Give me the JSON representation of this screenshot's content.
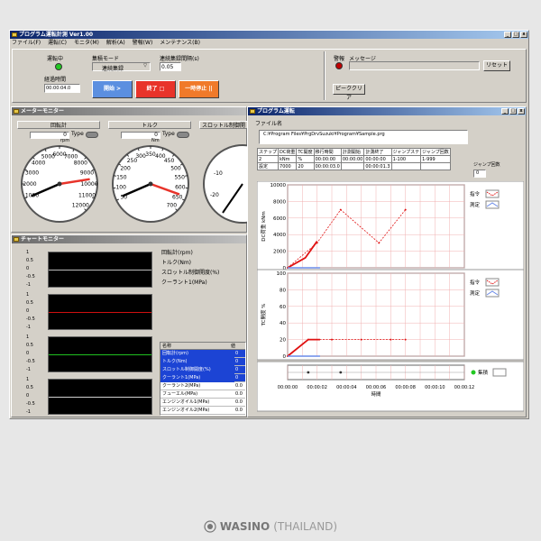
{
  "window": {
    "title": "プログラム運転計測 Ver1.00"
  },
  "menu": [
    "ファイル(F)",
    "運転(C)",
    "モニタ(M)",
    "解析(A)",
    "警報(W)",
    "メンテナンス(B)"
  ],
  "status": {
    "running_label": "運転中",
    "mode_label": "集積モード",
    "mode_value": "連続集録",
    "interval_label": "連続集録間隔(s)",
    "interval_value": "0.05",
    "elapsed_label": "経過時間",
    "elapsed_value": "00:00:04.0",
    "start_label": "開始 >",
    "stop_label": "終了 □",
    "pause_label": "一時停止 ||",
    "alarm_label": "警報",
    "message_label": "メッセージ",
    "reset_label": "リセット",
    "peak_clear_label": "ピーククリア"
  },
  "meter_monitor": {
    "title": "メーターモニター",
    "gauges": [
      {
        "name": "回転計",
        "type_label": "Type",
        "value": "0",
        "unit": "rpm",
        "ticks": [
          "1000",
          "2000",
          "3000",
          "4000",
          "5000",
          "6000",
          "7000",
          "8000",
          "9000",
          "10000",
          "11000",
          "12000"
        ],
        "needle_value": 9000,
        "min": 0,
        "max": 12000
      },
      {
        "name": "トルク",
        "type_label": "Type",
        "value": "0",
        "unit": "Nm",
        "ticks": [
          "50",
          "100",
          "150",
          "200",
          "250",
          "300",
          "350",
          "400",
          "450",
          "500",
          "550",
          "600",
          "650",
          "700"
        ],
        "needle_value": 600,
        "min": 0,
        "max": 700
      },
      {
        "name": "スロットル制御開",
        "ticks": [
          "-10",
          "-20"
        ]
      }
    ]
  },
  "chart_monitor": {
    "title": "チャートモニター",
    "channels": [
      "回転計(rpm)",
      "トルク(Nm)",
      "スロットル制御開度(%)",
      "クーラント1(MPa)"
    ],
    "strip_ticks": [
      "1",
      "0.5",
      "0",
      "-0.5",
      "-1"
    ],
    "table_header_name": "名称",
    "table_header_value": "値",
    "table_rows": [
      {
        "name": "回転計(rpm)",
        "value": "0",
        "selected": true
      },
      {
        "name": "トルク(Nm)",
        "value": "0",
        "selected": true
      },
      {
        "name": "スロットル制御開度(%)",
        "value": "0",
        "selected": true
      },
      {
        "name": "クーラント1(MPa)",
        "value": "0",
        "selected": true
      },
      {
        "name": "クーラント2(MPa)",
        "value": "0.0",
        "selected": false
      },
      {
        "name": "フューエル(MPa)",
        "value": "0.0",
        "selected": false
      },
      {
        "name": "エンジンオイル1(MPa)",
        "value": "0.0",
        "selected": false
      },
      {
        "name": "エンジンオイル2(MPa)",
        "value": "0.0",
        "selected": false
      },
      {
        "name": "ベンチ室差圧(MPa)",
        "value": "0.0",
        "selected": false
      }
    ]
  },
  "program_window": {
    "title": "プログラム運転",
    "file_label": "ファイル名",
    "file_path": "C:¥Program Files¥PrgDrvSuzuki¥Program¥Sample.prg",
    "table_headers": [
      "ステップ",
      "DC荷重",
      "TC開度",
      "移行時間",
      "計測開始",
      "計測終了",
      "ジャンプステ",
      "ジャンプ回数"
    ],
    "table_subheaders": [
      "2",
      "kNm",
      "%",
      "00:00:00",
      "00:00:00",
      "00:00:00",
      "1-100",
      "1-999"
    ],
    "table_row_label": "設定",
    "table_row": [
      "7000",
      "20",
      "00:00:03.0",
      "",
      "00:00:01.3",
      "",
      ""
    ],
    "jump_count_label": "ジャンプ回数",
    "jump_count_value": "0",
    "legend": {
      "command": "指令",
      "measured": "測定"
    },
    "collect_label": "集積",
    "time_label": "時間"
  },
  "chart_data": [
    {
      "type": "line",
      "ylabel": "DC荷重 kNm",
      "ylim": [
        0,
        10000
      ],
      "yticks": [
        "0",
        "2000",
        "4000",
        "6000",
        "8000",
        "10000"
      ],
      "x": [
        "00:00:00",
        "00:00:02",
        "00:00:04",
        "00:00:06",
        "00:00:08",
        "00:00:10",
        "00:00:12"
      ],
      "series": [
        {
          "name": "指令",
          "points": [
            [
              0,
              0
            ],
            [
              2,
              3000
            ],
            [
              3.6,
              7000
            ],
            [
              6.2,
              3000
            ],
            [
              8,
              7000
            ]
          ]
        },
        {
          "name": "測定",
          "points": [
            [
              0,
              0
            ],
            [
              1.2,
              1200
            ],
            [
              2,
              3200
            ]
          ]
        }
      ]
    },
    {
      "type": "line",
      "ylabel": "TC開度 %",
      "ylim": [
        0,
        100
      ],
      "yticks": [
        "0",
        "20",
        "40",
        "60",
        "80",
        "100"
      ],
      "x": [
        "00:00:00",
        "00:00:02",
        "00:00:04",
        "00:00:06",
        "00:00:08",
        "00:00:10",
        "00:00:12"
      ],
      "series": [
        {
          "name": "指令",
          "points": [
            [
              0,
              0
            ],
            [
              1.4,
              20
            ],
            [
              3,
              20
            ],
            [
              5,
              20
            ],
            [
              7,
              20
            ],
            [
              8,
              20
            ]
          ]
        },
        {
          "name": "測定",
          "points": [
            [
              0,
              0
            ],
            [
              1.4,
              20
            ],
            [
              2.2,
              20
            ]
          ]
        }
      ]
    }
  ],
  "footer": {
    "brand": "WASINO",
    "region": "(THAILAND)"
  },
  "colors": {
    "accent_blue": "#1c44d4",
    "start_blue": "#5b8fe0",
    "stop_red": "#e8332a",
    "pause_orange": "#f07a2a",
    "led_green": "#22c822",
    "led_red": "#c00000",
    "plot_red": "#e01010"
  }
}
